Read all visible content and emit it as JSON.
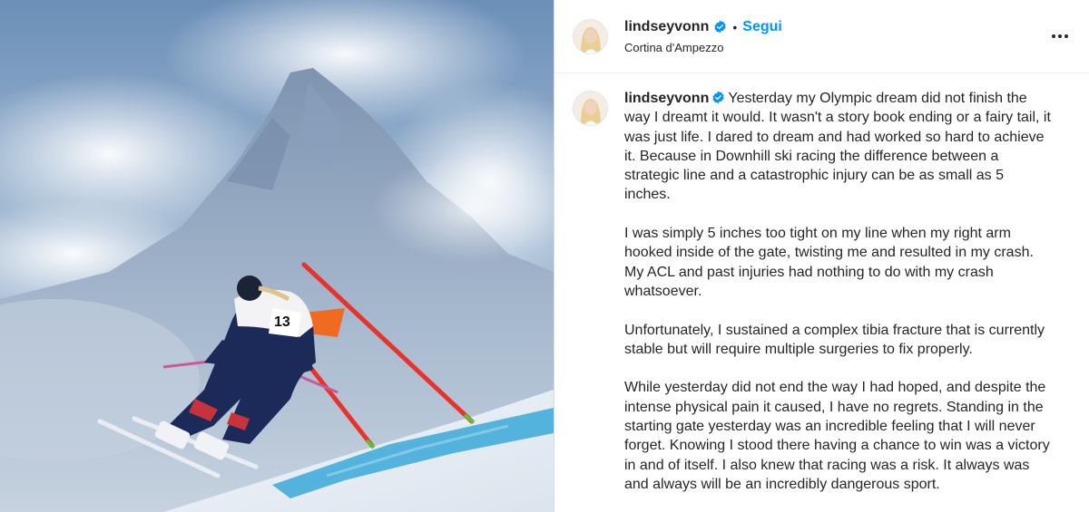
{
  "post": {
    "username": "lindseyvonn",
    "follow_label": "Segui",
    "separator": "•",
    "location": "Cortina d'Ampezzo",
    "more_icon": "more-horizontal-icon",
    "image": {
      "bib_number": "13"
    }
  },
  "caption": {
    "username": "lindseyvonn",
    "paragraphs": [
      "Yesterday my Olympic dream did not finish the way I dreamt it would. It wasn't a story book ending or a fairy tail, it was just life. I dared to dream and had worked so hard to achieve it. Because in Downhill ski racing the difference between a strategic line and a catastrophic injury can be as small as 5 inches.",
      "I was simply 5 inches too tight on my line when my right arm hooked inside of the gate, twisting me and resulted in my crash. My ACL and past injuries had nothing to do with my crash whatsoever.",
      "Unfortunately, I sustained a complex tibia fracture that is currently stable but will require multiple surgeries to fix properly.",
      "While yesterday did not end the way I had hoped, and despite the intense physical pain it caused, I have no regrets. Standing in the starting gate yesterday was an incredible feeling that I will never forget. Knowing I stood there having a chance to win was a victory in and of itself. I also knew that racing was a risk. It always was and always will be an incredibly dangerous sport."
    ]
  },
  "colors": {
    "follow": "#0095f6",
    "verified": "#0095f6",
    "text": "#262626"
  }
}
